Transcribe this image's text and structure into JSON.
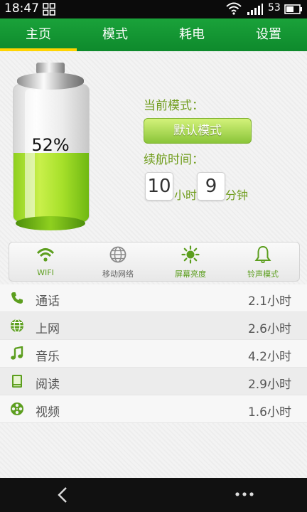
{
  "status_bar": {
    "time": "18:47",
    "battery_level": "53"
  },
  "tabs": [
    {
      "label": "主页",
      "active": true
    },
    {
      "label": "模式",
      "active": false
    },
    {
      "label": "耗电",
      "active": false
    },
    {
      "label": "设置",
      "active": false
    }
  ],
  "battery": {
    "percent_label": "52%",
    "level": 0.52
  },
  "mode": {
    "current_label": "当前模式：",
    "button_label": "默认模式",
    "endurance_label": "续航时间：",
    "hours": "10",
    "hours_unit": "小时",
    "minutes": "9",
    "minutes_unit": "分钟"
  },
  "shortcuts": [
    {
      "label": "WIFI",
      "icon": "wifi-icon",
      "color": "#5c9e1e"
    },
    {
      "label": "移动网络",
      "icon": "globe-icon",
      "color": "#666666"
    },
    {
      "label": "屏幕亮度",
      "icon": "sun-icon",
      "color": "#5c9e1e"
    },
    {
      "label": "铃声模式",
      "icon": "bell-icon",
      "color": "#5c9e1e"
    }
  ],
  "usage": [
    {
      "name": "通话",
      "duration": "2.1小时",
      "icon": "phone-icon"
    },
    {
      "name": "上网",
      "duration": "2.6小时",
      "icon": "globe-icon"
    },
    {
      "name": "音乐",
      "duration": "4.2小时",
      "icon": "music-icon"
    },
    {
      "name": "阅读",
      "duration": "2.9小时",
      "icon": "book-icon"
    },
    {
      "name": "视频",
      "duration": "1.6小时",
      "icon": "film-reel-icon"
    }
  ],
  "colors": {
    "brand_green": "#1aa23a",
    "tab_indicator": "#ffd400",
    "accent_green": "#6f9c1b"
  }
}
